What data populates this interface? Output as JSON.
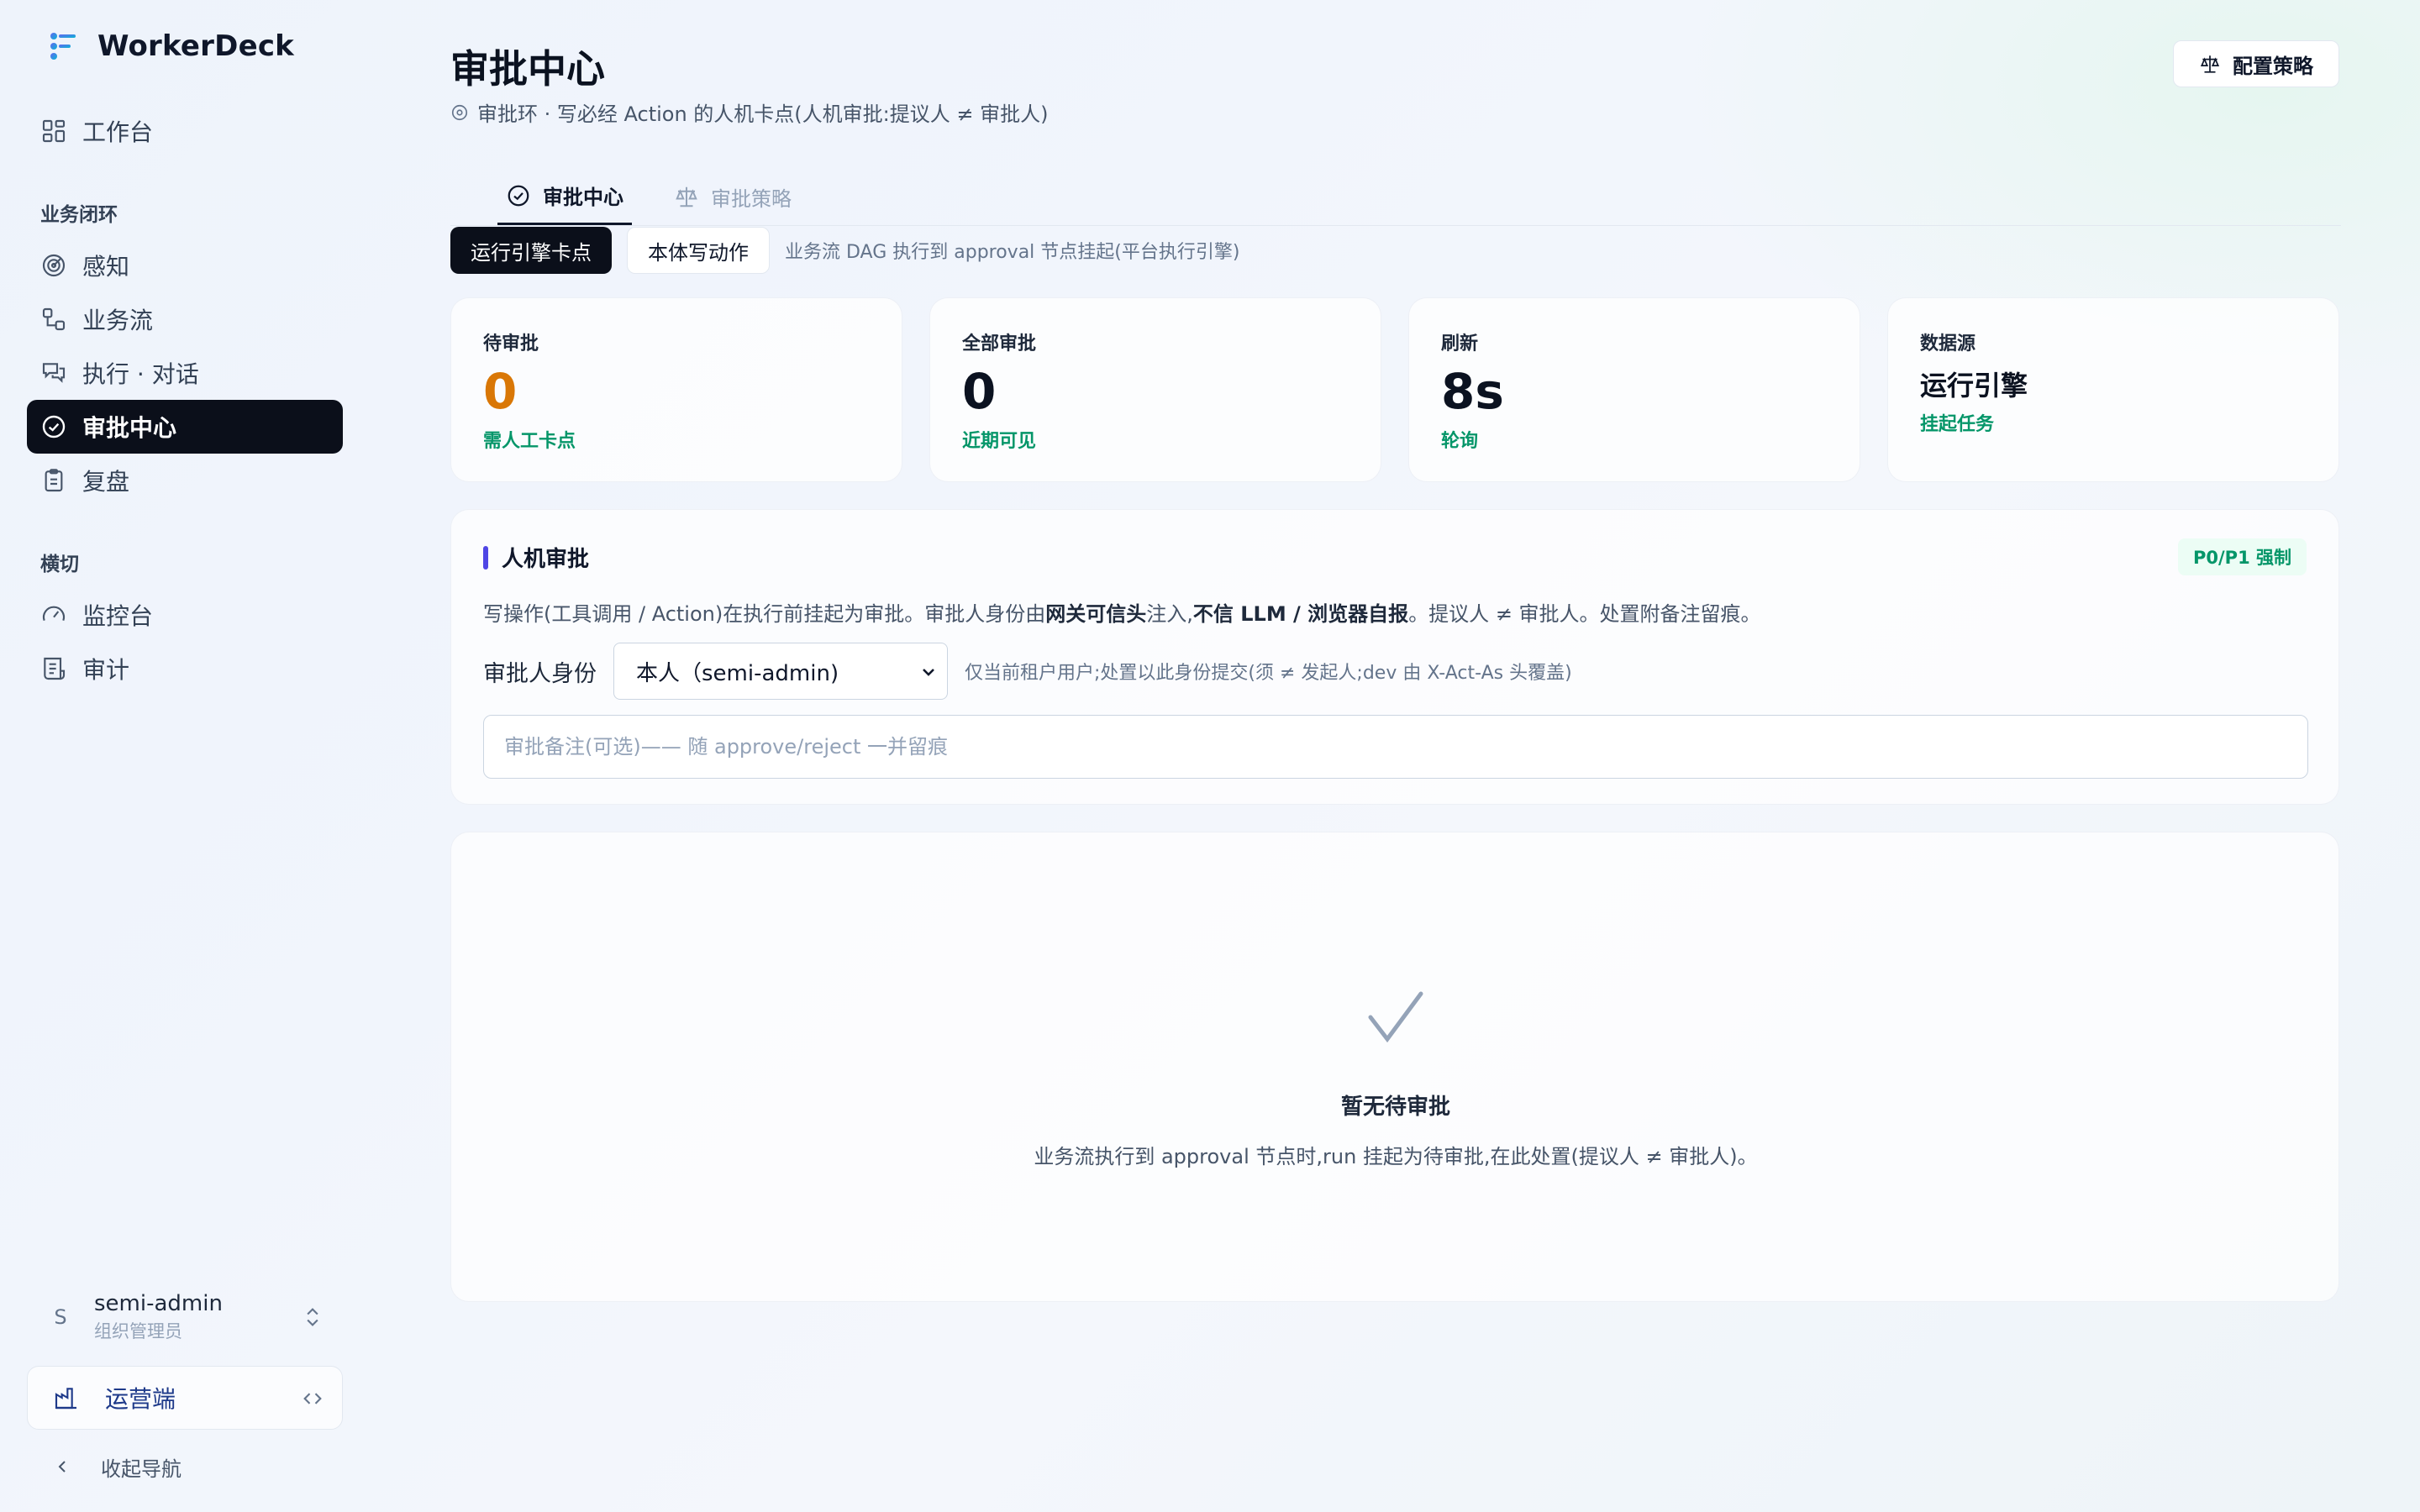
{
  "brand": {
    "name": "WorkerDeck"
  },
  "nav": {
    "top": [
      {
        "label": "工作台",
        "icon": "grid-icon"
      }
    ],
    "sections": [
      {
        "title": "业务闭环",
        "items": [
          {
            "label": "感知",
            "icon": "radar-icon"
          },
          {
            "label": "业务流",
            "icon": "workflow-icon"
          },
          {
            "label": "执行 · 对话",
            "icon": "chat-icon"
          },
          {
            "label": "审批中心",
            "icon": "check-circle-icon",
            "active": true
          },
          {
            "label": "复盘",
            "icon": "clipboard-icon"
          }
        ]
      },
      {
        "title": "横切",
        "items": [
          {
            "label": "监控台",
            "icon": "gauge-icon"
          },
          {
            "label": "审计",
            "icon": "receipt-icon"
          }
        ]
      }
    ]
  },
  "user": {
    "initial": "S",
    "name": "semi-admin",
    "role": "组织管理员"
  },
  "ops": {
    "label": "运营端"
  },
  "collapse": {
    "label": "收起导航"
  },
  "page": {
    "title": "审批中心",
    "subtitle": "审批环 · 写必经 Action 的人机卡点(人机审批:提议人 ≠ 审批人)",
    "config_button": "配置策略"
  },
  "tabs": [
    {
      "label": "审批中心",
      "active": true
    },
    {
      "label": "审批策略",
      "active": false
    }
  ],
  "segment": {
    "options": [
      {
        "label": "运行引擎卡点",
        "active": true
      },
      {
        "label": "本体写动作",
        "active": false
      }
    ],
    "hint": "业务流 DAG 执行到 approval 节点挂起(平台执行引擎)"
  },
  "stats": [
    {
      "label": "待审批",
      "value": "0",
      "sub": "需人工卡点"
    },
    {
      "label": "全部审批",
      "value": "0",
      "sub": "近期可见"
    },
    {
      "label": "刷新",
      "value": "8s",
      "sub": "轮询"
    },
    {
      "label": "数据源",
      "value": "运行引擎",
      "sub": "挂起任务"
    }
  ],
  "panel": {
    "title": "人机审批",
    "badge": "P0/P1 强制",
    "desc": {
      "part1": "写操作(工具调用 / Action)在执行前挂起为审批。审批人身份由",
      "bold1": "网关可信头",
      "part2": "注入,",
      "bold2": "不信 LLM / 浏览器自报",
      "part3": "。提议人 ≠ 审批人。处置附备注留痕。"
    },
    "approver_label": "审批人身份",
    "approver_value": "本人（semi-admin)",
    "approver_hint": "仅当前租户用户;处置以此身份提交(须 ≠ 发起人;dev 由 X-Act-As 头覆盖)",
    "note_placeholder": "审批备注(可选)—— 随 approve/reject 一并留痕",
    "note_value": ""
  },
  "empty": {
    "title": "暂无待审批",
    "desc": "业务流执行到 approval 节点时,run 挂起为待审批,在此处置(提议人 ≠ 审批人)。"
  },
  "colors": {
    "accent_dark": "#0b0f1a",
    "pending_orange": "#d97706",
    "success_green": "#059669",
    "panel_bar": "#4f46e5"
  }
}
